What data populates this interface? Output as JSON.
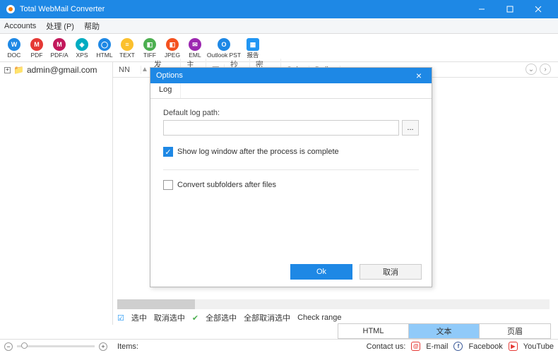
{
  "titlebar": {
    "title": "Total WebMail Converter"
  },
  "menu": {
    "accounts": "Accounts",
    "process": "处理 (P)",
    "help": "帮助"
  },
  "toolbar": [
    {
      "id": "doc",
      "label": "DOC",
      "char": "W",
      "color": "#1e88e5"
    },
    {
      "id": "pdf",
      "label": "PDF",
      "char": "M",
      "color": "#e53935"
    },
    {
      "id": "pdfa",
      "label": "PDF/A",
      "char": "M",
      "color": "#c2185b"
    },
    {
      "id": "xps",
      "label": "XPS",
      "char": "◈",
      "color": "#00acc1"
    },
    {
      "id": "html",
      "label": "HTML",
      "char": "◯",
      "color": "#1e88e5"
    },
    {
      "id": "text",
      "label": "TEXT",
      "char": "≡",
      "color": "#fbc02d"
    },
    {
      "id": "tiff",
      "label": "TIFF",
      "char": "◧",
      "color": "#4caf50"
    },
    {
      "id": "jpeg",
      "label": "JPEG",
      "char": "◧",
      "color": "#f4511e"
    },
    {
      "id": "eml",
      "label": "EML",
      "char": "✉",
      "color": "#9c27b0"
    },
    {
      "id": "outlookpst",
      "label": "Outlook PST",
      "char": "O",
      "color": "#1e88e5",
      "wide": true
    },
    {
      "id": "report",
      "label": "报告",
      "char": "▦",
      "color": "#2196f3",
      "square": true
    }
  ],
  "tree": {
    "account": "admin@gmail.com"
  },
  "list": {
    "cols": {
      "nn": "NN",
      "sender": "发件...",
      "subject": "主题",
      "lord": "至",
      "cc": "抄送",
      "bcc": "密件...",
      "subj2": "Sub...",
      "deliv": "Deliv..."
    }
  },
  "selection": {
    "select": "选中",
    "deselect": "取消选中",
    "selectall": "全部选中",
    "deselectall": "全部取消选中",
    "checkrange": "Check range"
  },
  "tabs": {
    "html": "HTML",
    "text": "文本",
    "header": "页眉"
  },
  "status": {
    "items": "Items:",
    "contact": "Contact us:",
    "email": "E-mail",
    "facebook": "Facebook",
    "youtube": "YouTube"
  },
  "dialog": {
    "title": "Options",
    "tab": "Log",
    "defaultLogPath": "Default log path:",
    "pathValue": "",
    "showLog": "Show log window after the process is complete",
    "convertSub": "Convert subfolders after files",
    "ok": "Ok",
    "cancel": "取消"
  }
}
